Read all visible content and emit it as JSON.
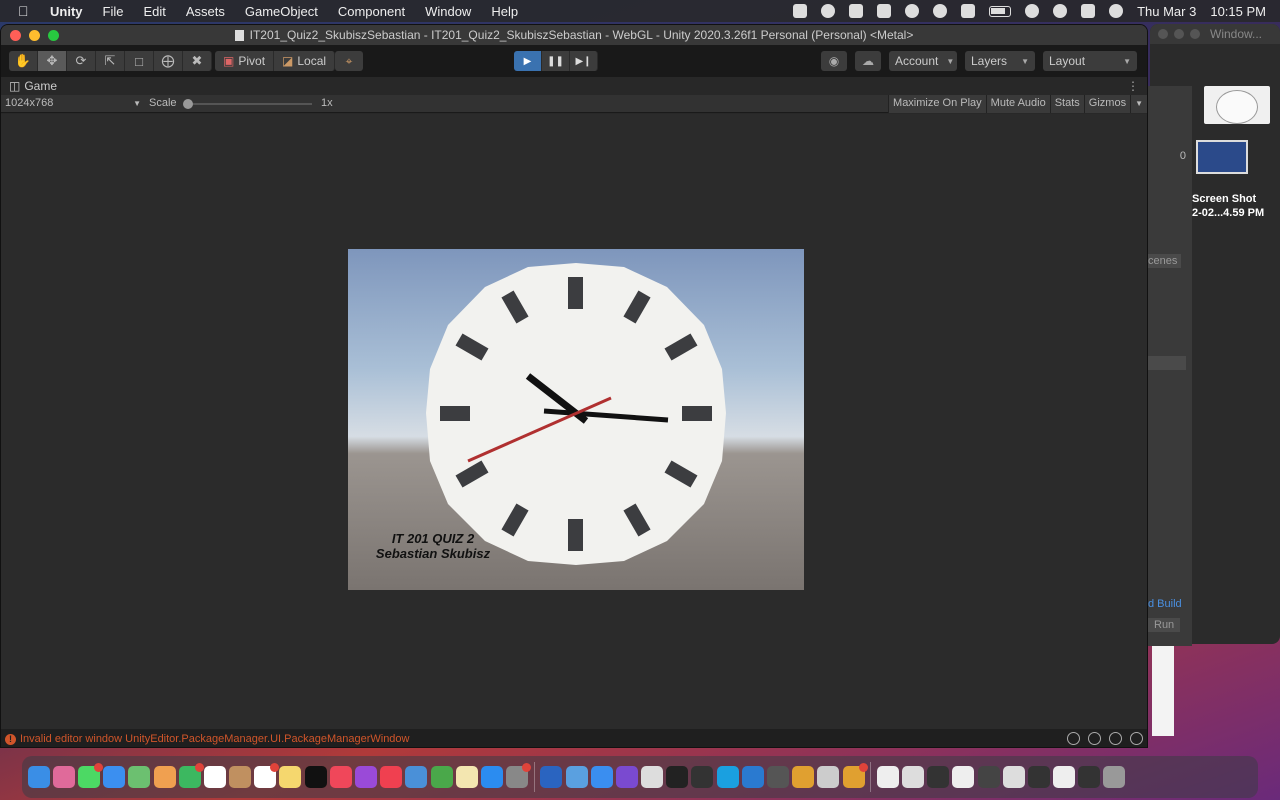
{
  "menubar": {
    "app": "Unity",
    "items": [
      "File",
      "Edit",
      "Assets",
      "GameObject",
      "Component",
      "Window",
      "Help"
    ],
    "date": "Thu Mar 3",
    "time": "10:15 PM"
  },
  "window": {
    "title": "IT201_Quiz2_SkubiszSebastian - IT201_Quiz2_SkubiszSebastian - WebGL - Unity 2020.3.26f1 Personal (Personal) <Metal>"
  },
  "toolbar": {
    "tools": [
      "hand-icon",
      "move-icon",
      "rotate-icon",
      "scale-icon",
      "rect-icon",
      "transform-icon",
      "custom-tool-icon"
    ],
    "pivot_label": "Pivot",
    "local_label": "Local",
    "account_label": "Account",
    "layers_label": "Layers",
    "layout_label": "Layout"
  },
  "game_tab": {
    "label": "Game",
    "resolution": "1024x768",
    "scale_label": "Scale",
    "scale_value": "1x",
    "options": [
      "Maximize On Play",
      "Mute Audio",
      "Stats",
      "Gizmos"
    ]
  },
  "scene": {
    "line1": "IT 201 QUIZ 2",
    "line2": "Sebastian Skubisz"
  },
  "console": {
    "message": "Invalid editor window UnityEditor.PackageManager.UI.PackageManagerWindow"
  },
  "background_window": {
    "title": "Window...",
    "value": "0",
    "scenes_label": "cenes",
    "build_label": "d Build",
    "run_label": "Run"
  },
  "desktop_file": {
    "line1": "Screen Shot",
    "line2": "2-02...4.59 PM"
  },
  "colors": {
    "accent": "#3a72b0",
    "error": "#d0552a",
    "second_hand": "#b03030"
  }
}
